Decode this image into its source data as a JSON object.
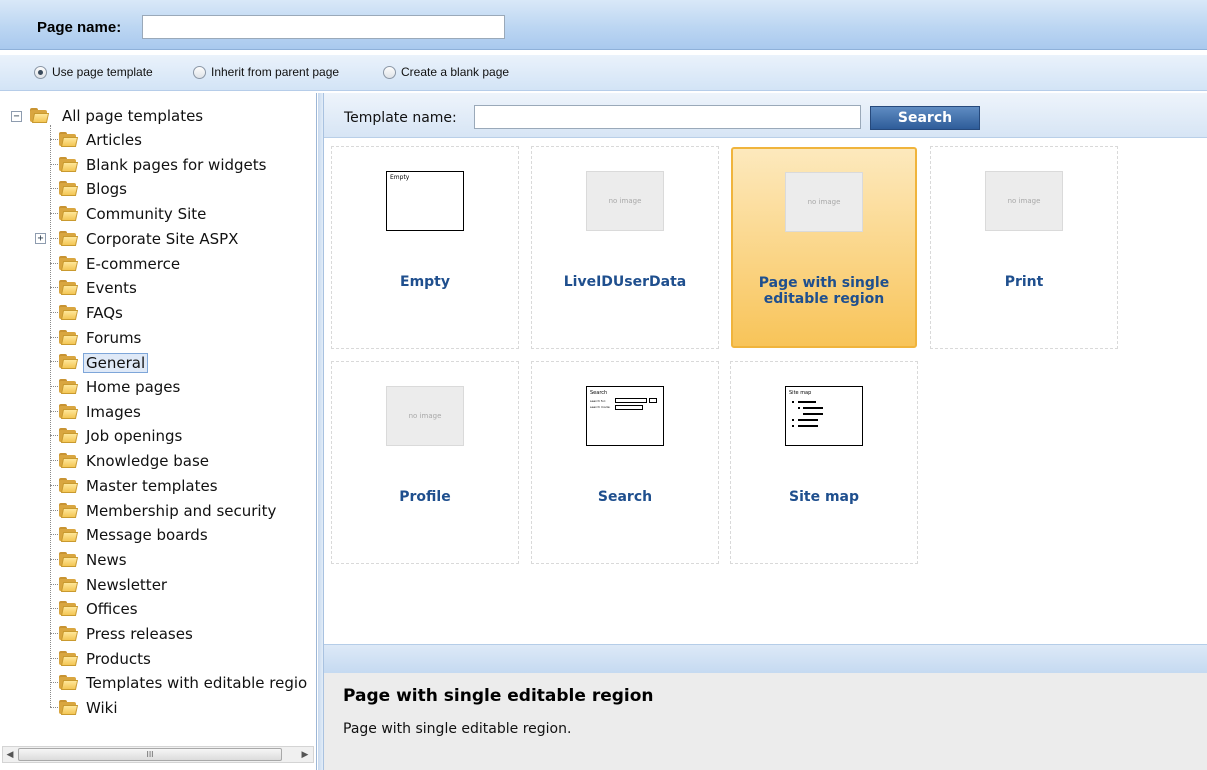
{
  "header": {
    "page_name_label": "Page name:",
    "page_name_value": ""
  },
  "options": [
    {
      "label": "Use page template",
      "checked": true
    },
    {
      "label": "Inherit from parent page",
      "checked": false
    },
    {
      "label": "Create a blank page",
      "checked": false
    }
  ],
  "tree": {
    "root": "All page templates",
    "items": [
      "Articles",
      "Blank pages for widgets",
      "Blogs",
      "Community Site",
      "Corporate Site ASPX",
      "E-commerce",
      "Events",
      "FAQs",
      "Forums",
      "General",
      "Home pages",
      "Images",
      "Job openings",
      "Knowledge base",
      "Master templates",
      "Membership and security",
      "Message boards",
      "News",
      "Newsletter",
      "Offices",
      "Press releases",
      "Products",
      "Templates with editable regio",
      "Wiki"
    ],
    "selected": "General",
    "expandable": "Corporate Site ASPX"
  },
  "search": {
    "label": "Template name:",
    "value": "",
    "button": "Search"
  },
  "templates": [
    {
      "name": "Empty",
      "thumb": "Empty",
      "selected": false
    },
    {
      "name": "LiveIDUserData",
      "thumb": "no image",
      "selected": false
    },
    {
      "name": "Page with single editable region",
      "thumb": "no image",
      "selected": true
    },
    {
      "name": "Print",
      "thumb": "no image",
      "selected": false
    },
    {
      "name": "Profile",
      "thumb": "no image",
      "selected": false
    },
    {
      "name": "Search",
      "thumb": "Search",
      "selected": false
    },
    {
      "name": "Site map",
      "thumb": "Site map",
      "selected": false
    }
  ],
  "details": {
    "title": "Page with single editable region",
    "description": "Page with single editable region."
  },
  "scrollbar": {
    "thumb_glyph": "III"
  },
  "thumb_text": {
    "empty": "Empty",
    "no_image": "no image",
    "search": "Search",
    "search_row1": "search for:",
    "search_row2": "search mode:",
    "sitemap": "Site map"
  }
}
